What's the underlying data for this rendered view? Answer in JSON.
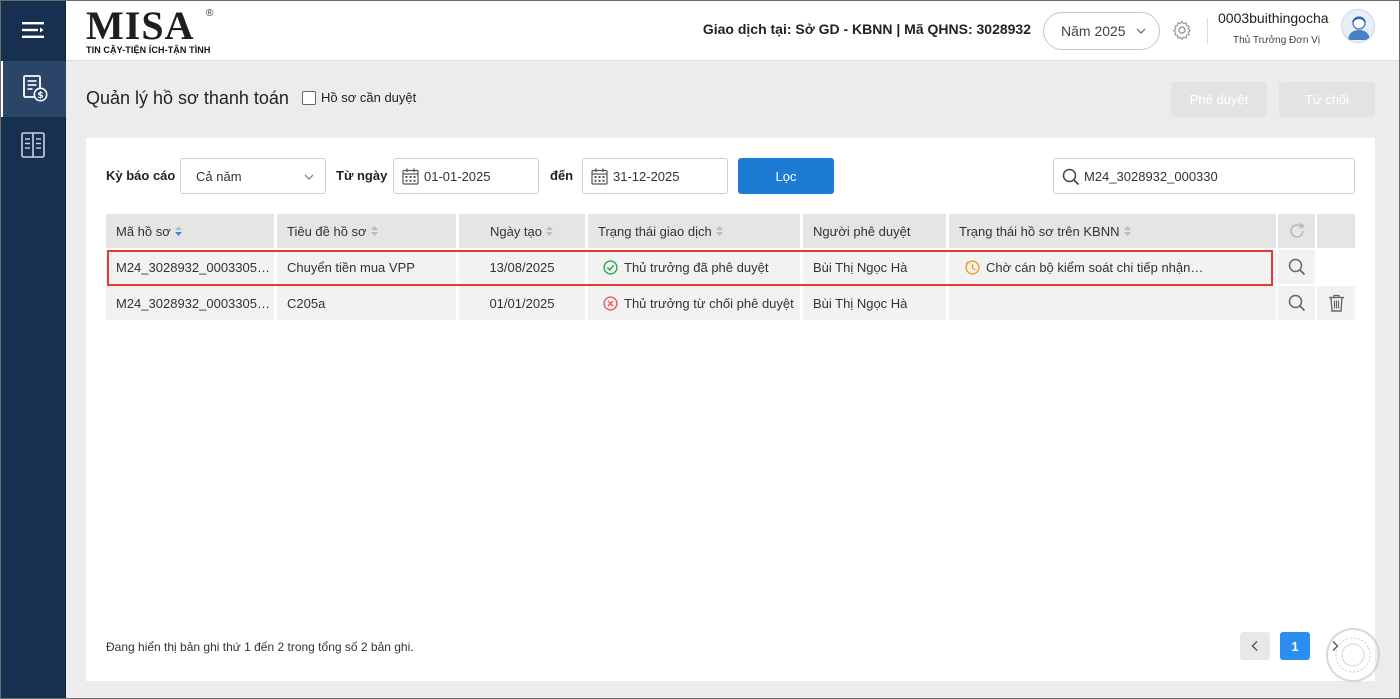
{
  "brand": {
    "logo_text": "MISA",
    "registered_mark": "®",
    "tagline": "TIN CẬY-TIỆN ÍCH-TẬN TÌNH"
  },
  "header": {
    "transaction_info": "Giao dịch tại: Sở GD - KBNN | Mã QHNS: 3028932",
    "year": "Năm 2025",
    "user_name": "0003buithingocha",
    "user_role": "Thủ Trưởng Đơn Vị"
  },
  "sidebar": {
    "items": [
      {
        "icon": "menu-toggle-icon"
      },
      {
        "icon": "payment-document-icon",
        "active": true
      },
      {
        "icon": "ledger-book-icon"
      }
    ]
  },
  "page": {
    "title": "Quản lý hồ sơ thanh toán",
    "need_approve_label": "Hồ sơ cần duyệt",
    "approve_button": "Phê duyệt",
    "reject_button": "Từ chối"
  },
  "filters": {
    "period_label": "Kỳ báo cáo",
    "period_value": "Cả năm",
    "from_label": "Từ ngày",
    "from_value": "01-01-2025",
    "to_label": "đến",
    "to_value": "31-12-2025",
    "filter_button": "Lọc",
    "search_value": "M24_3028932_000330"
  },
  "table": {
    "columns": [
      "Mã hồ sơ",
      "Tiêu đề hồ sơ",
      "Ngày tạo",
      "Trạng thái giao dịch",
      "Người phê duyệt",
      "Trạng thái hồ sơ trên KBNN"
    ],
    "rows": [
      {
        "code": "M24_3028932_0003305…",
        "title": "Chuyển tiền mua VPP",
        "created": "13/08/2025",
        "txn_status": "Thủ trưởng đã phê duyệt",
        "txn_status_type": "approved",
        "approver": "Bùi Thị Ngọc Hà",
        "kbnn_status": "Chờ cán bộ kiểm soát chi tiếp nhận…",
        "highlighted": true
      },
      {
        "code": "M24_3028932_0003305…",
        "title": "C205a",
        "created": "01/01/2025",
        "txn_status": "Thủ trưởng từ chối phê duyệt",
        "txn_status_type": "rejected",
        "approver": "Bùi Thị Ngọc Hà",
        "kbnn_status": "",
        "highlighted": false
      }
    ]
  },
  "footer": {
    "record_info": "Đang hiển thị bản ghi thứ 1 đến 2 trong tổng số 2 bản ghi.",
    "current_page": "1"
  },
  "colors": {
    "sidebar": "#17304f",
    "primary": "#1d7bd4",
    "approved": "#2fa84f",
    "rejected": "#e85a5a",
    "pending": "#f0a020",
    "highlight": "#e53935"
  }
}
